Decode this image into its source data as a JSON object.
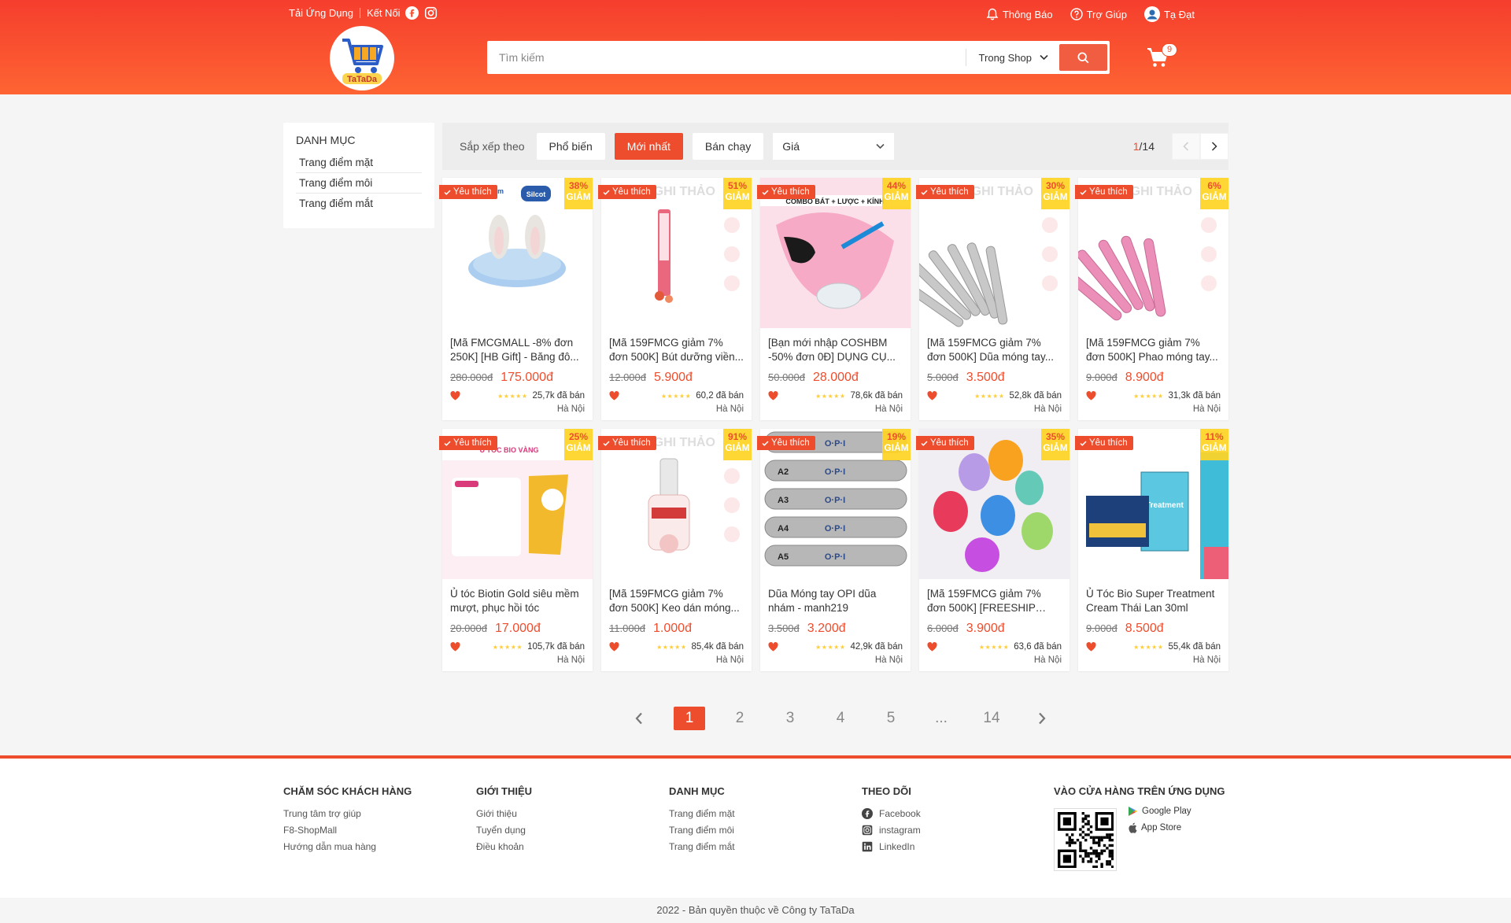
{
  "header": {
    "download_app": "Tải Ứng Dụng",
    "connect": "Kết Nối",
    "notifications": "Thông Báo",
    "help": "Trợ Giúp",
    "username": "Tạ Đạt",
    "logo_text": "TaTaDa",
    "search_placeholder": "Tìm kiếm",
    "search_scope": "Trong Shop",
    "cart_count": "9"
  },
  "sidebar": {
    "title": "DANH MỤC",
    "items": [
      "Trang điểm mặt",
      "Trang điểm môi",
      "Trang điểm mắt"
    ]
  },
  "filter": {
    "sort_label": "Sắp xếp theo",
    "options": [
      "Phổ biến",
      "Mới nhất",
      "Bán chạy"
    ],
    "active": "Mới nhất",
    "price_label": "Giá",
    "page_current": "1",
    "page_total": "/14"
  },
  "products": [
    {
      "fav": "Yêu thích",
      "discount": "38%",
      "giam": "GIẢM",
      "name": "[Mã FMCGMALL -8% đơn 250K] [HB Gift] - Băng đô...",
      "old_price": "280.000đ",
      "price": "175.000đ",
      "stars": "★★★★★",
      "sold": "25,7k đã bán",
      "location": "Hà Nội",
      "img_theme": "headband",
      "img_brand": "unkharm",
      "img_brand2": "Silcot"
    },
    {
      "fav": "Yêu thích",
      "discount": "51%",
      "giam": "GIẢM",
      "name": "[Mã 159FMCG giảm 7% đơn 500K] Bút dưỡng viền...",
      "old_price": "12.000đ",
      "price": "5.900đ",
      "stars": "★★★★★",
      "sold": "60,2 đã bán",
      "location": "Hà Nội",
      "img_theme": "pen",
      "img_brand": "NGHI THẢO"
    },
    {
      "fav": "Yêu thích",
      "discount": "44%",
      "giam": "GIẢM",
      "name": "[Bạn mới nhập COSHBM -50% đơn 0Đ] DỤNG CỤ...",
      "old_price": "50.000đ",
      "price": "28.000đ",
      "stars": "★★★★★",
      "sold": "78,6k đã bán",
      "location": "Hà Nội",
      "img_theme": "bowl",
      "img_brand": "COMBO BÁT + LƯỢC + KÍNH"
    },
    {
      "fav": "Yêu thích",
      "discount": "30%",
      "giam": "GIẢM",
      "name": "[Mã 159FMCG giảm 7% đơn 500K] Dũa móng tay...",
      "old_price": "5.000đ",
      "price": "3.500đ",
      "stars": "★★★★★",
      "sold": "52,8k đã bán",
      "location": "Hà Nội",
      "img_theme": "files-grey",
      "img_brand": "NGHI THẢO"
    },
    {
      "fav": "Yêu thích",
      "discount": "6%",
      "giam": "GIẢM",
      "name": "[Mã 159FMCG giảm 7% đơn 500K] Phao móng tay...",
      "old_price": "9.000đ",
      "price": "8.900đ",
      "stars": "★★★★★",
      "sold": "31,3k đã bán",
      "location": "Hà Nội",
      "img_theme": "files-pink",
      "img_brand": "NGHI THẢO"
    },
    {
      "fav": "Yêu thích",
      "discount": "25%",
      "giam": "GIẢM",
      "name": "Ủ tóc Biotin Gold siêu mềm mượt, phục hồi tóc",
      "old_price": "20.000đ",
      "price": "17.000đ",
      "stars": "★★★★★",
      "sold": "105,7k đã bán",
      "location": "Hà Nội",
      "img_theme": "bio",
      "img_brand": "Ủ TÓC BIO VÀNG"
    },
    {
      "fav": "Yêu thích",
      "discount": "91%",
      "giam": "GIẢM",
      "name": "[Mã 159FMCG giảm 7% đơn 500K] Keo dán móng...",
      "old_price": "11.000đ",
      "price": "1.000đ",
      "stars": "★★★★★",
      "sold": "85,4k đã bán",
      "location": "Hà Nội",
      "img_theme": "glue",
      "img_brand": "NGHI THẢO"
    },
    {
      "fav": "Yêu thích",
      "discount": "19%",
      "giam": "GIẢM",
      "name": "Dũa Móng tay OPI dũa nhám - manh219",
      "old_price": "3.500đ",
      "price": "3.200đ",
      "stars": "★★★★★",
      "sold": "42,9k đã bán",
      "location": "Hà Nội",
      "img_theme": "opi",
      "img_brand": "O·P·I"
    },
    {
      "fav": "Yêu thích",
      "discount": "35%",
      "giam": "GIẢM",
      "name": "[Mã 159FMCG giảm 7% đơn 500K] [FREESHIP TỪ...",
      "old_price": "6.000đ",
      "price": "3.900đ",
      "stars": "★★★★★",
      "sold": "63,6 đã bán",
      "location": "Hà Nội",
      "img_theme": "sponges",
      "img_brand": ""
    },
    {
      "fav": "Yêu thích",
      "discount": "11%",
      "giam": "GIẢM",
      "name": "Ủ Tóc Bio Super Treatment Cream Thái Lan 30ml",
      "old_price": "9.000đ",
      "price": "8.500đ",
      "stars": "★★★★★",
      "sold": "55,4k đã bán",
      "location": "Hà Nội",
      "img_theme": "treatment",
      "img_brand": "Treatment"
    }
  ],
  "pagination": {
    "prev": "‹",
    "pages": [
      "1",
      "2",
      "3",
      "4",
      "5",
      "...",
      "14"
    ],
    "next": "›",
    "active": "1"
  },
  "footer": {
    "col1": {
      "title": "CHĂM SÓC KHÁCH HÀNG",
      "items": [
        "Trung tâm trợ giúp",
        "F8-ShopMall",
        "Hướng dẫn mua hàng"
      ]
    },
    "col2": {
      "title": "GIỚI THIỆU",
      "items": [
        "Giới thiệu",
        "Tuyển dụng",
        "Điều khoản"
      ]
    },
    "col3": {
      "title": "DANH MỤC",
      "items": [
        "Trang điểm mặt",
        "Trang điểm môi",
        "Trang điểm mắt"
      ]
    },
    "col4": {
      "title": "THEO DÕI",
      "items": [
        "Facebook",
        "instagram",
        "LinkedIn"
      ]
    },
    "col5": {
      "title": "VÀO CỬA HÀNG TRÊN ỨNG DỤNG",
      "google_play": "Google Play",
      "app_store": "App Store"
    },
    "copyright": "2022 - Bản quyền thuộc về Công ty TaTaDa"
  },
  "colors": {
    "brand": "#ee4d2d",
    "header_start": "#f53e2d",
    "header_end": "#fe6433",
    "discount_bg": "#ffd424",
    "star": "#ffce3d"
  }
}
